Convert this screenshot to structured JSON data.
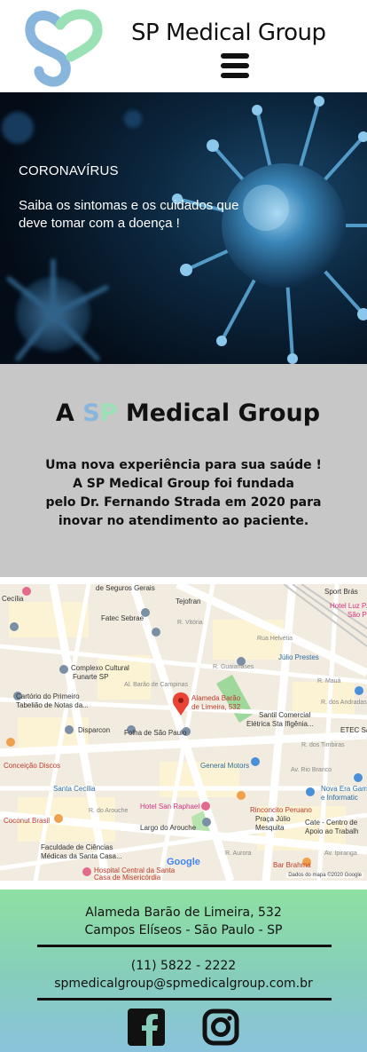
{
  "header": {
    "brand": "SP Medical Group",
    "logo_colors": {
      "left": "#87b5dc",
      "right": "#9ae2b5"
    }
  },
  "hero": {
    "kicker": "CORONAVÍRUS",
    "text": "Saiba os sintomas e os cuidados que deve tomar com a doença !"
  },
  "about": {
    "title_prefix": "A ",
    "title_s": "S",
    "title_p": "P",
    "title_suffix": " Medical Group",
    "body_lines": [
      "Uma nova experiência para sua saúde !",
      "A SP Medical Group foi fundada",
      "pelo Dr. Fernando Strada em 2020 para",
      "inovar no atendimento ao paciente."
    ]
  },
  "map": {
    "labels": {
      "seguros": "de Seguros Gerais",
      "tejofran": "Tejofran",
      "sportbras": "Sport Brás",
      "hotelluz": "Hotel Luz P.",
      "saopa": "São Pa",
      "cecilia": "Cecília",
      "fatec": "Fatec Sebrae",
      "helvetia": "Rua Helvétia",
      "julio": "Júlio Prestes",
      "complexo": "Complexo Cultural",
      "funarte": "Funarte SP",
      "cartorio1": "Cartório do Primeiro",
      "cartorio2": "Tabelião de Notas da...",
      "pin1": "Alameda Barão",
      "pin2": "de Limeira, 532",
      "santil1": "Santil Comercial",
      "santil2": "Elétrica Sta Ifigênia...",
      "maua": "R. Mauá",
      "disparcon": "Disparcon",
      "folha": "Folha de São Paulo",
      "etec": "ETEC Sa",
      "conceicao": "Conceição Discos",
      "general": "General Motors",
      "santacecilia": "Santa Cecília",
      "novaera1": "Nova Era Gam",
      "novaera2": "e Informatic",
      "coconut": "Coconut Brasil",
      "hotelsr": "Hotel San Raphael",
      "rinconcito": "Rinconcito Peruano",
      "pjulio1": "Praça Júlio",
      "pjulio2": "Mesquita",
      "cate1": "Cate - Centro de",
      "cate2": "Apoio ao Trabalh",
      "largo": "Largo do Arouche",
      "faculdade1": "Faculdade de Ciências",
      "faculdade2": "Médicas da Santa Casa...",
      "hospital1": "Hospital Central da Santa",
      "hospital2": "Casa de Misericórdia",
      "barbrahma": "Bar Brahma",
      "aurora": "R. Aurora",
      "ipiranga": "Av. Ipiranga",
      "riobranco": "Av. Rio Branco",
      "duquecaxias": "Al. Barão de Campinas",
      "guaianases": "R. Guaianases",
      "vitoria": "R. Vitória",
      "andradas": "R. dos Andradas",
      "timbiras": "R. dos Timbiras",
      "arouche": "R. do Arouche"
    },
    "google": "Google",
    "attribution": "Dados do mapa ©2020 Google"
  },
  "footer": {
    "address_line1": "Alameda Barão de Limeira, 532",
    "address_line2": "Campos Elíseos - São Paulo - SP",
    "phone": "(11) 5822 - 2222",
    "email": "spmedicalgroup@spmedicalgroup.com.br",
    "gradient_top": "#8ee0a2",
    "gradient_bottom": "#8ac3dd"
  }
}
